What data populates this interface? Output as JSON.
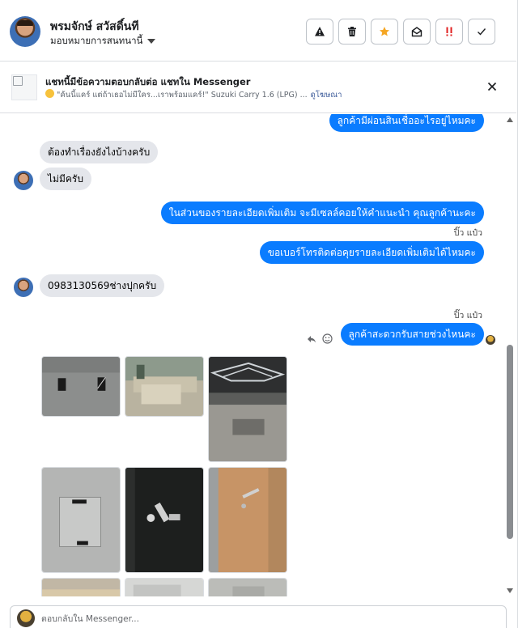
{
  "header": {
    "name": "พรมจักษ์ สวัสดิ์นที",
    "assign_label": "มอบหมายการสนทนานี้",
    "actions": [
      {
        "icon": "warning-icon"
      },
      {
        "icon": "trash-icon"
      },
      {
        "icon": "star-icon",
        "color": "#f5a623"
      },
      {
        "icon": "mark-unread-icon"
      },
      {
        "icon": "follow-up-icon",
        "color": "#e02020"
      },
      {
        "icon": "check-icon"
      }
    ]
  },
  "banner": {
    "title": "แชทนี้มีข้อความตอบกลับต่อ แชทใน Messenger",
    "snippet": "\"ค้นนี้แคร์ แต่ถ้าเธอไม่มีใคร...เราพร้อมแคร์!\" Suzuki Carry 1.6 (LPG) ...",
    "ad_link": "ดูโฆษณา"
  },
  "messages": {
    "m1": "ลูกค้ามีผ่อนสินเชื่ออะไรอยู่ไหมคะ",
    "m2": "ต้องทำเรื่องยังไงบ้างครับ",
    "m3": "ไม่มีครับ",
    "m4": "ในส่วนของรายละเอียดเพิ่มเติม จะมีเซลล์คอยให้คำแนะนำ คุณลูกค้านะคะ",
    "m4_sender": "ปิ๊ว แป๋ว",
    "m5": "ขอเบอร์โทรติดต่อคุยรายละเอียดเพิ่มเติมได้ไหมคะ",
    "m6": "0983130569ช่างปุกครับ",
    "m7_sender": "ปิ๊ว แป๋ว",
    "m7": "ลูกค้าสะดวกรับสายช่วงไหนคะ"
  },
  "colors": {
    "outgoing_bubble": "#0a7cff",
    "incoming_bubble": "#e4e6eb"
  },
  "composer": {
    "placeholder": "ตอบกลับใน Messenger..."
  }
}
